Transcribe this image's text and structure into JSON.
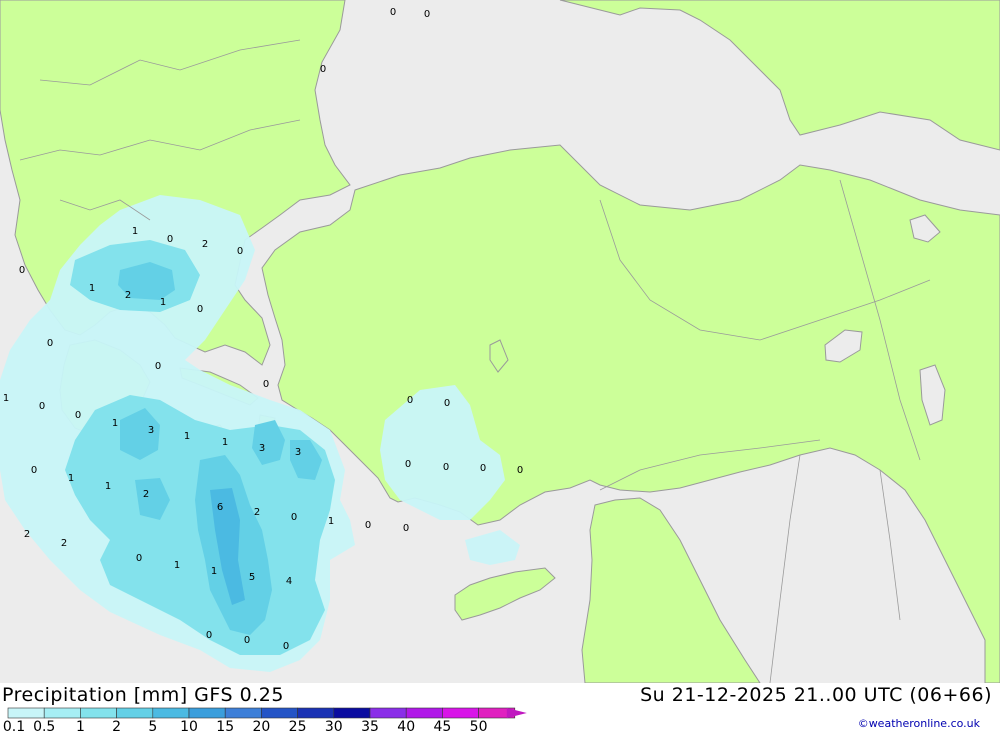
{
  "header": {
    "title": "Precipitation [mm] GFS 0.25",
    "datetime": "Su 21-12-2025 21..00 UTC (06+66)",
    "copyright": "©weatheronline.co.uk"
  },
  "legend": {
    "labels": [
      "0.1",
      "0.5",
      "1",
      "2",
      "5",
      "10",
      "15",
      "20",
      "25",
      "30",
      "35",
      "40",
      "45",
      "50"
    ],
    "colors": [
      "#c8f5f8",
      "#a6eef4",
      "#83e2ec",
      "#63d0e6",
      "#4bbae2",
      "#3a9edc",
      "#3d7fd8",
      "#2454c6",
      "#1a32b4",
      "#0a0ca0",
      "#8a2ee8",
      "#b018e8",
      "#d814e8",
      "#e020c0"
    ]
  },
  "map": {
    "colors": {
      "sea": "#ececec",
      "land": "#ccff99",
      "border": "#9a9a9a",
      "precip_light": "#c8f5f8",
      "precip_mid": "#83e2ec",
      "precip_strong": "#4bbae2",
      "precip_heavy": "#3a9edc"
    },
    "labels": [
      "0",
      "0",
      "0",
      "1",
      "0",
      "2",
      "0",
      "0",
      "1",
      "2",
      "1",
      "0",
      "0",
      "0",
      "0",
      "1",
      "0",
      "0",
      "3",
      "1",
      "1",
      "3",
      "3",
      "0",
      "0",
      "0",
      "0",
      "0",
      "0",
      "1",
      "1",
      "2",
      "1",
      "6",
      "2",
      "0",
      "1",
      "0",
      "0",
      "0",
      "0",
      "1",
      "1",
      "5",
      "4",
      "2",
      "0",
      "2",
      "0",
      "0"
    ]
  }
}
